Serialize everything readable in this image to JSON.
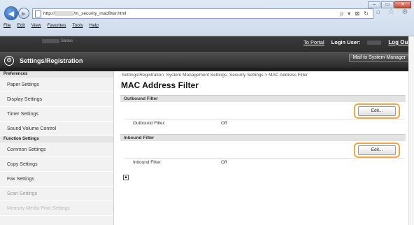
{
  "browser": {
    "address": "http://",
    "address_rest": "/m_security_macfilter.html",
    "address_tools": "ρ ▾ ⊠ ↻",
    "right_icons": "⌂ ☆ ⚙",
    "window_controls": [
      "–",
      "▭",
      "✕"
    ],
    "menu": [
      "File",
      "Edit",
      "View",
      "Favorites",
      "Tools",
      "Help"
    ]
  },
  "header": {
    "device_prefix": "Series",
    "to_portal": "To Portal",
    "login_user_label": "Login User:",
    "log_out": "Log Out",
    "app_title": "Settings/Registration",
    "mail_button": "Mail to System Manager"
  },
  "sidebar": {
    "sections": [
      {
        "heading": "Preferences",
        "items": [
          "Paper Settings",
          "Display Settings",
          "Timer Settings",
          "Sound Volume Control"
        ]
      },
      {
        "heading": "Function Settings",
        "items": [
          "Common Settings",
          "Copy Settings",
          "Fax Settings",
          "Scan Settings",
          "Memory Media Print Settings"
        ]
      }
    ]
  },
  "main": {
    "breadcrumb": "Settings/Registration: System Management Settings: Security Settings > MAC Address Filter",
    "title": "MAC Address Filter",
    "outbound": {
      "section_title": "Outbound Filter",
      "edit_label": "Edit...",
      "field_label": "Outbound Filter:",
      "field_value": "Off"
    },
    "inbound": {
      "section_title": "Inbound Filter",
      "edit_label": "Edit...",
      "field_label": "Inbound Filter:",
      "field_value": "Off"
    },
    "back_to_top_icon": "▲"
  },
  "colors": {
    "header_bg": "#2a2a2a",
    "highlight_ring": "#f0a83a",
    "section_bg": "#e3e3e3",
    "sidebar_bg": "#f2f2f2"
  }
}
